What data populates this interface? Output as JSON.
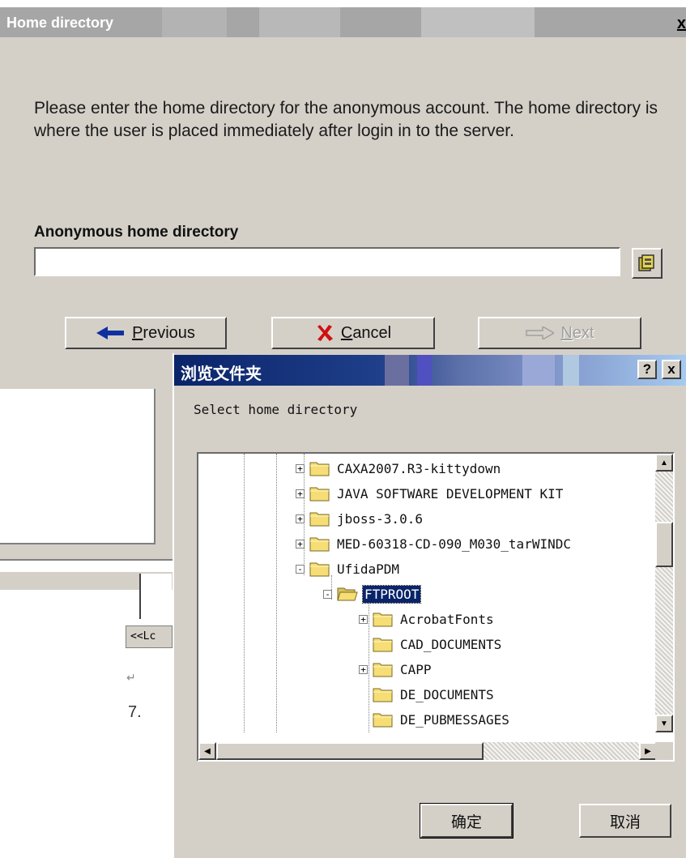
{
  "wizard": {
    "title": "Home directory",
    "close_glyph": "x",
    "description": "Please enter the home directory for the anonymous account. The home directory is where the user is placed immediately after login in to the server.",
    "field_label": "Anonymous home directory",
    "field_value": "",
    "browse_icon": "folder-browse-icon",
    "buttons": {
      "previous_prefix": "",
      "previous_mnemonic": "P",
      "previous_rest": "revious",
      "cancel_mnemonic": "C",
      "cancel_rest": "ancel",
      "next_mnemonic": "N",
      "next_rest": "ext"
    }
  },
  "background": {
    "log_button": "<<Lc",
    "para_mark": "↵",
    "list_number": "7."
  },
  "browse_dialog": {
    "title": "浏览文件夹",
    "help_glyph": "?",
    "close_glyph": "x",
    "prompt": "Select home directory",
    "tree": [
      {
        "label": "CAXA2007.R3-kittydown",
        "expander": "+",
        "selected": false
      },
      {
        "label": "JAVA SOFTWARE DEVELOPMENT KIT",
        "expander": "+",
        "selected": false
      },
      {
        "label": "jboss-3.0.6",
        "expander": "+",
        "selected": false
      },
      {
        "label": "MED-60318-CD-090_M030_tarWINDC",
        "expander": "+",
        "selected": false
      },
      {
        "label": "UfidaPDM",
        "expander": "-",
        "selected": false
      },
      {
        "label": "FTPROOT",
        "expander": "-",
        "selected": true
      },
      {
        "label": "AcrobatFonts",
        "expander": "+",
        "selected": false
      },
      {
        "label": "CAD_DOCUMENTS",
        "expander": "",
        "selected": false
      },
      {
        "label": "CAPP",
        "expander": "+",
        "selected": false
      },
      {
        "label": "DE_DOCUMENTS",
        "expander": "",
        "selected": false
      },
      {
        "label": "DE_PUBMESSAGES",
        "expander": "",
        "selected": false
      }
    ],
    "ok_label": "确定",
    "cancel_label": "取消"
  },
  "colors": {
    "dialog_face": "#d4d0c8",
    "selection": "#0a246a",
    "folder_yellow": "#f6dd76"
  }
}
